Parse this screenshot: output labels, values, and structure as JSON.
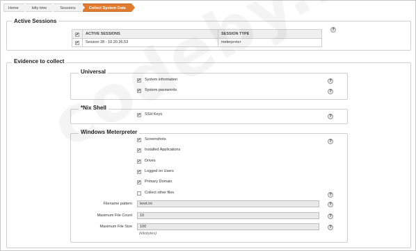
{
  "breadcrumb": [
    "Home",
    "kitty time",
    "Sessions",
    "Collect System Data"
  ],
  "active_sessions": {
    "title": "Active Sessions",
    "columns": [
      "ACTIVE SESSIONS",
      "SESSION TYPE"
    ],
    "rows": [
      {
        "name": "Session 28 - 10.20.36.53",
        "type": "meterpreter",
        "checked": true
      }
    ],
    "help": "?"
  },
  "evidence": {
    "title": "Evidence to collect",
    "universal": {
      "title": "Universal",
      "items": [
        {
          "label": "System information",
          "checked": true
        },
        {
          "label": "System passwords",
          "checked": true
        }
      ]
    },
    "nix": {
      "title": "*Nix Shell",
      "items": [
        {
          "label": "SSH Keys",
          "checked": true
        }
      ]
    },
    "windows": {
      "title": "Windows Meterpreter",
      "items": [
        {
          "label": "Screenshots",
          "checked": true
        },
        {
          "label": "Installed Applications",
          "checked": true
        },
        {
          "label": "Drives",
          "checked": true
        },
        {
          "label": "Logged on Users",
          "checked": true
        },
        {
          "label": "Primary Domain",
          "checked": true
        },
        {
          "label": "Collect other files",
          "checked": false
        }
      ],
      "fields": [
        {
          "label": "Filename pattern",
          "value": "boot.ini"
        },
        {
          "label": "Maximum File Count",
          "value": "10"
        },
        {
          "label": "Maximum File Size",
          "value": "100",
          "hint": "(kilobytes)"
        }
      ]
    }
  },
  "help_glyph": "?",
  "check_glyph": "✔",
  "watermark": "codeby.net",
  "colors": {
    "accent": "#e07a2e",
    "border": "#cfcfcf"
  }
}
